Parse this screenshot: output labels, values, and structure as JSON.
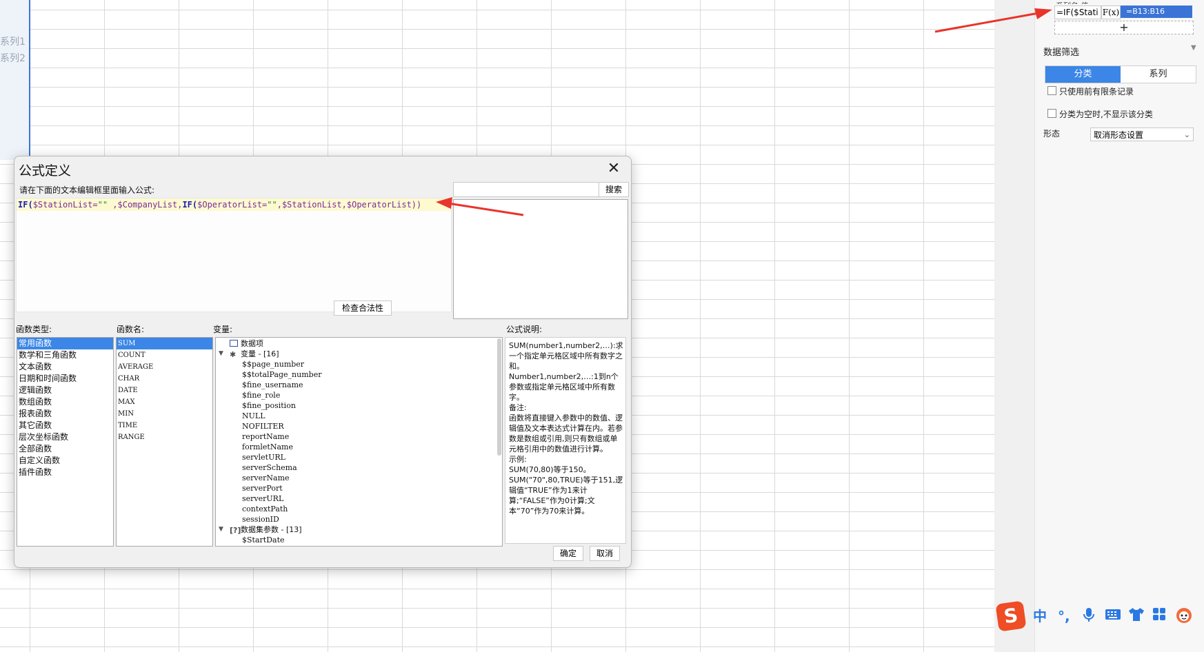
{
  "sheet": {
    "legend": [
      "系列1",
      "系列2"
    ]
  },
  "panel": {
    "cut_header": "系列名                           值",
    "formula_text": "=IF($Stati",
    "fx_label": "F(x)",
    "formula_value": "=B13:B16",
    "add_label": "+",
    "filter_title": "数据筛选",
    "tabs": [
      "分类",
      "系列"
    ],
    "options": [
      "只使用前有限条记录",
      "分类为空时,不显示该分类"
    ],
    "shape_label": "形态",
    "shape_value": "取消形态设置"
  },
  "dialog": {
    "title": "公式定义",
    "close": "✕",
    "prompt": "请在下面的文本编辑框里面输入公式:",
    "formula": {
      "full": "IF($StationList=\"\" ,$CompanyList,IF($OperatorList=\"\",$StationList,$OperatorList))",
      "parts": [
        "IF(",
        "$StationList=",
        "\"\"",
        " ,$CompanyList,",
        "IF(",
        "$OperatorList=",
        "\"\"",
        ",$StationList,$OperatorList))"
      ]
    },
    "search_placeholder": "",
    "search_button": "搜索",
    "check_button": "检查合法性",
    "labels": {
      "func_type": "函数类型:",
      "func_name": "函数名:",
      "variables": "变量:",
      "description": "公式说明:"
    },
    "func_types": [
      "常用函数",
      "数学和三角函数",
      "文本函数",
      "日期和时间函数",
      "逻辑函数",
      "数组函数",
      "报表函数",
      "其它函数",
      "层次坐标函数",
      "全部函数",
      "自定义函数",
      "插件函数"
    ],
    "func_names": [
      "SUM",
      "COUNT",
      "AVERAGE",
      "CHAR",
      "DATE",
      "MAX",
      "MIN",
      "TIME",
      "RANGE"
    ],
    "variables_tree": {
      "data_item": "数据项",
      "var_group": "变量 - [16]",
      "vars": [
        "$$page_number",
        "$$totalPage_number",
        "$fine_username",
        "$fine_role",
        "$fine_position",
        "NULL",
        "NOFILTER",
        "reportName",
        "formletName",
        "servletURL",
        "serverSchema",
        "serverName",
        "serverPort",
        "serverURL",
        "contextPath",
        "sessionID"
      ],
      "param_group": "数据集参数 - [13]",
      "params": [
        "$StartDate"
      ]
    },
    "description_lines": [
      "SUM(number1,number2,…):求一个指定单元格区域中所有数字之和。",
      "Number1,number2,…:1到n个参数或指定单元格区域中所有数字。",
      "备注:",
      "函数将直接键入参数中的数值、逻辑值及文本表达式计算在内。若参数是数组或引用,则只有数组或单元格引用中的数值进行计算。",
      "示例:",
      "SUM(70,80)等于150。",
      "SUM(\"70\",80,TRUE)等于151,逻辑值“TRUE”作为1来计算;“FALSE”作为0计算;文本“70”作为70来计算。"
    ],
    "ok": "确定",
    "cancel": "取消"
  },
  "ime": {
    "logo": "S",
    "items": [
      "中",
      "°,",
      "mic-icon",
      "keyboard-icon",
      "shirt-icon",
      "apps-icon",
      "mascot-icon"
    ],
    "lang": "中",
    "punct": "°,"
  },
  "colors": {
    "accent": "#3b86e6",
    "arrow": "#e8342a",
    "formula_bg": "#fdfad0"
  }
}
